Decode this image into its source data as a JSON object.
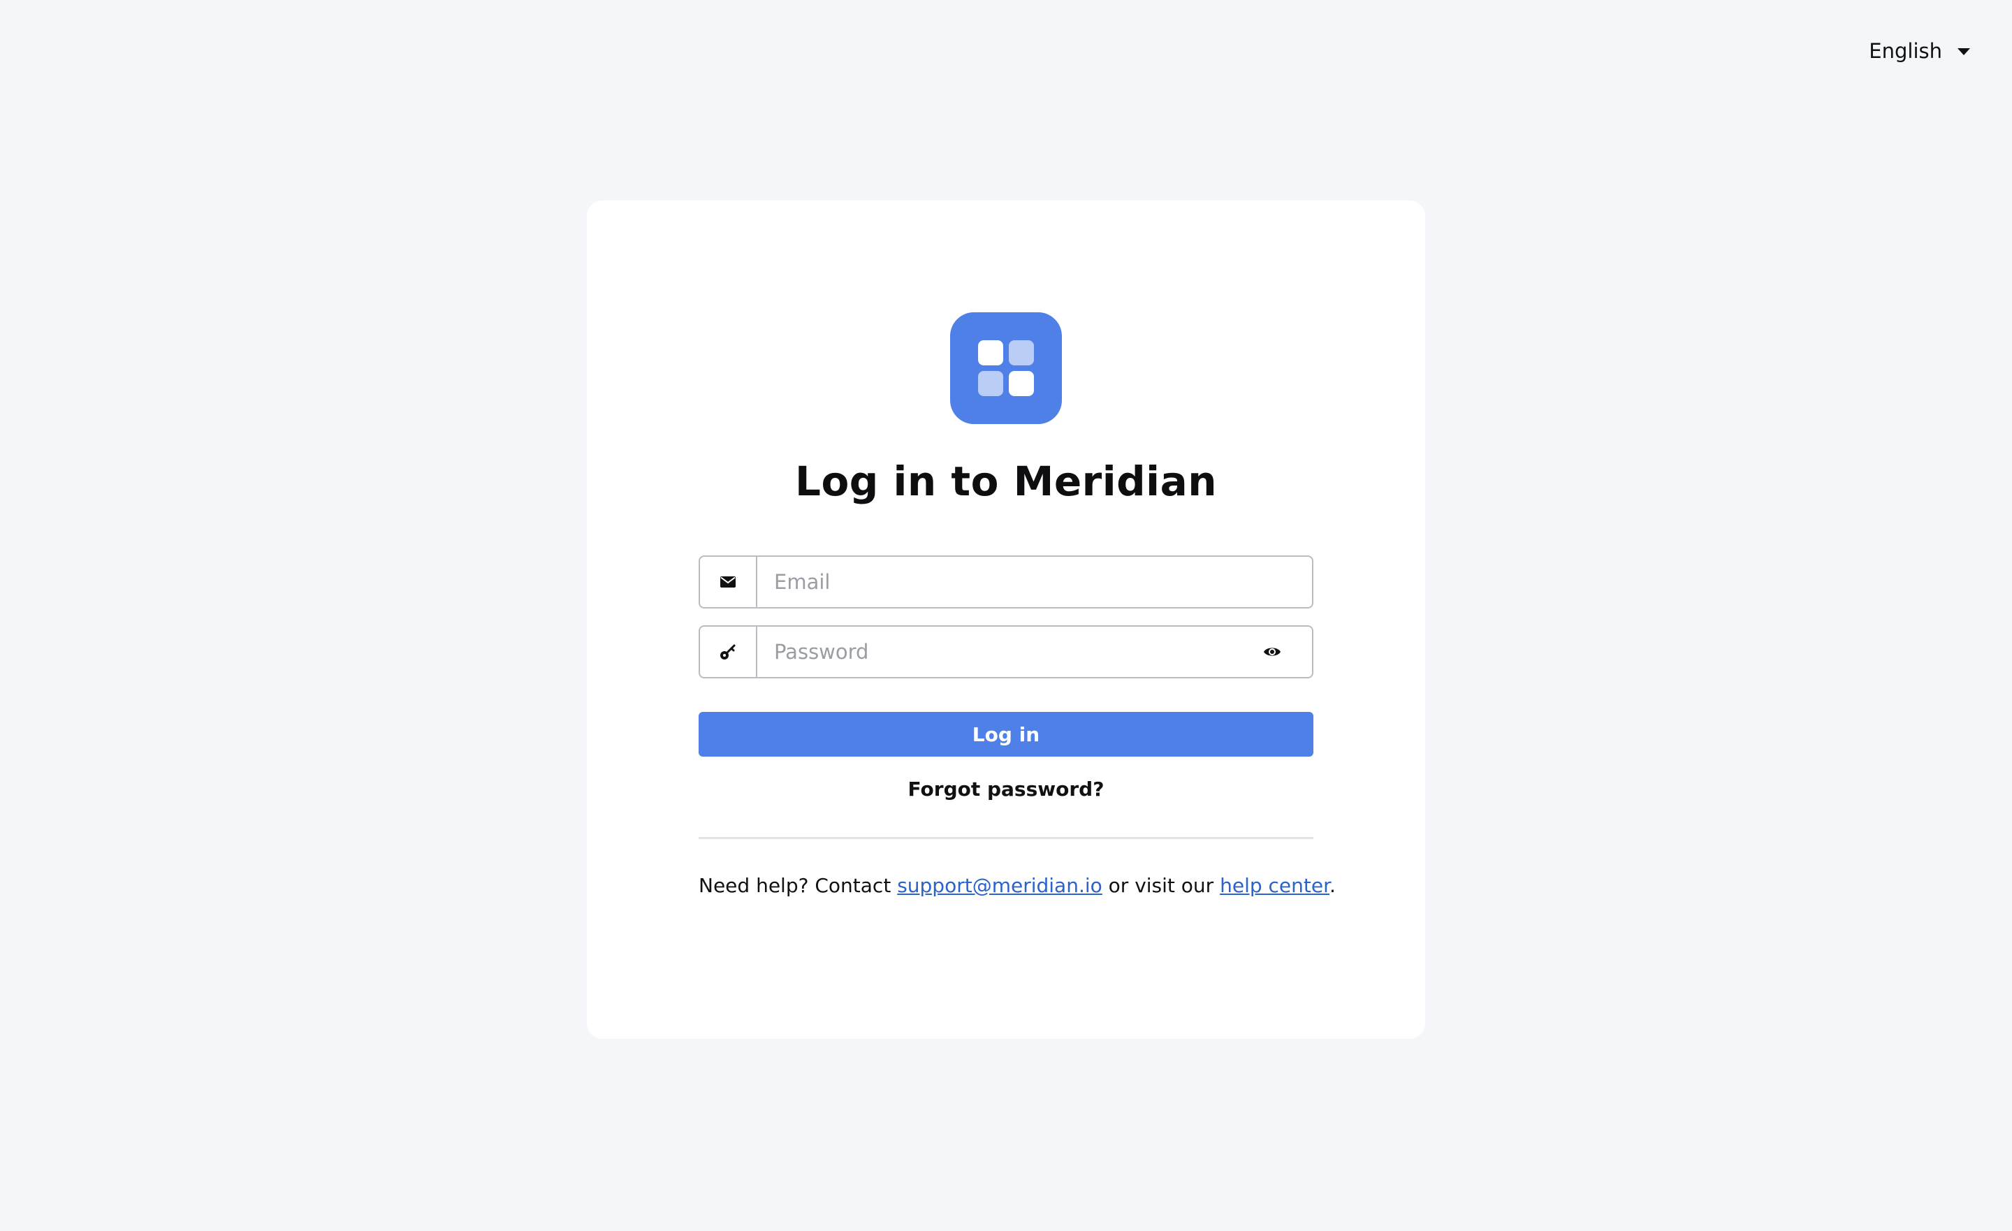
{
  "language_selector": {
    "value": "English",
    "caret_icon": "caret-down-icon"
  },
  "brand": {
    "logo_icon": "app-grid-logo-icon",
    "accent_color": "#4e80e8"
  },
  "login": {
    "title": "Log in to Meridian",
    "email": {
      "icon": "envelope-icon",
      "placeholder": "Email",
      "value": ""
    },
    "password": {
      "icon": "key-icon",
      "placeholder": "Password",
      "value": "",
      "toggle_icon": "eye-icon"
    },
    "submit_label": "Log in",
    "forgot_label": "Forgot password?"
  },
  "help": {
    "prefix": "Need help? Contact ",
    "email_link": "support@meridian.io",
    "middle": " or visit our ",
    "center_link": "help center",
    "suffix": ".",
    "link_color": "#2c63c8"
  }
}
